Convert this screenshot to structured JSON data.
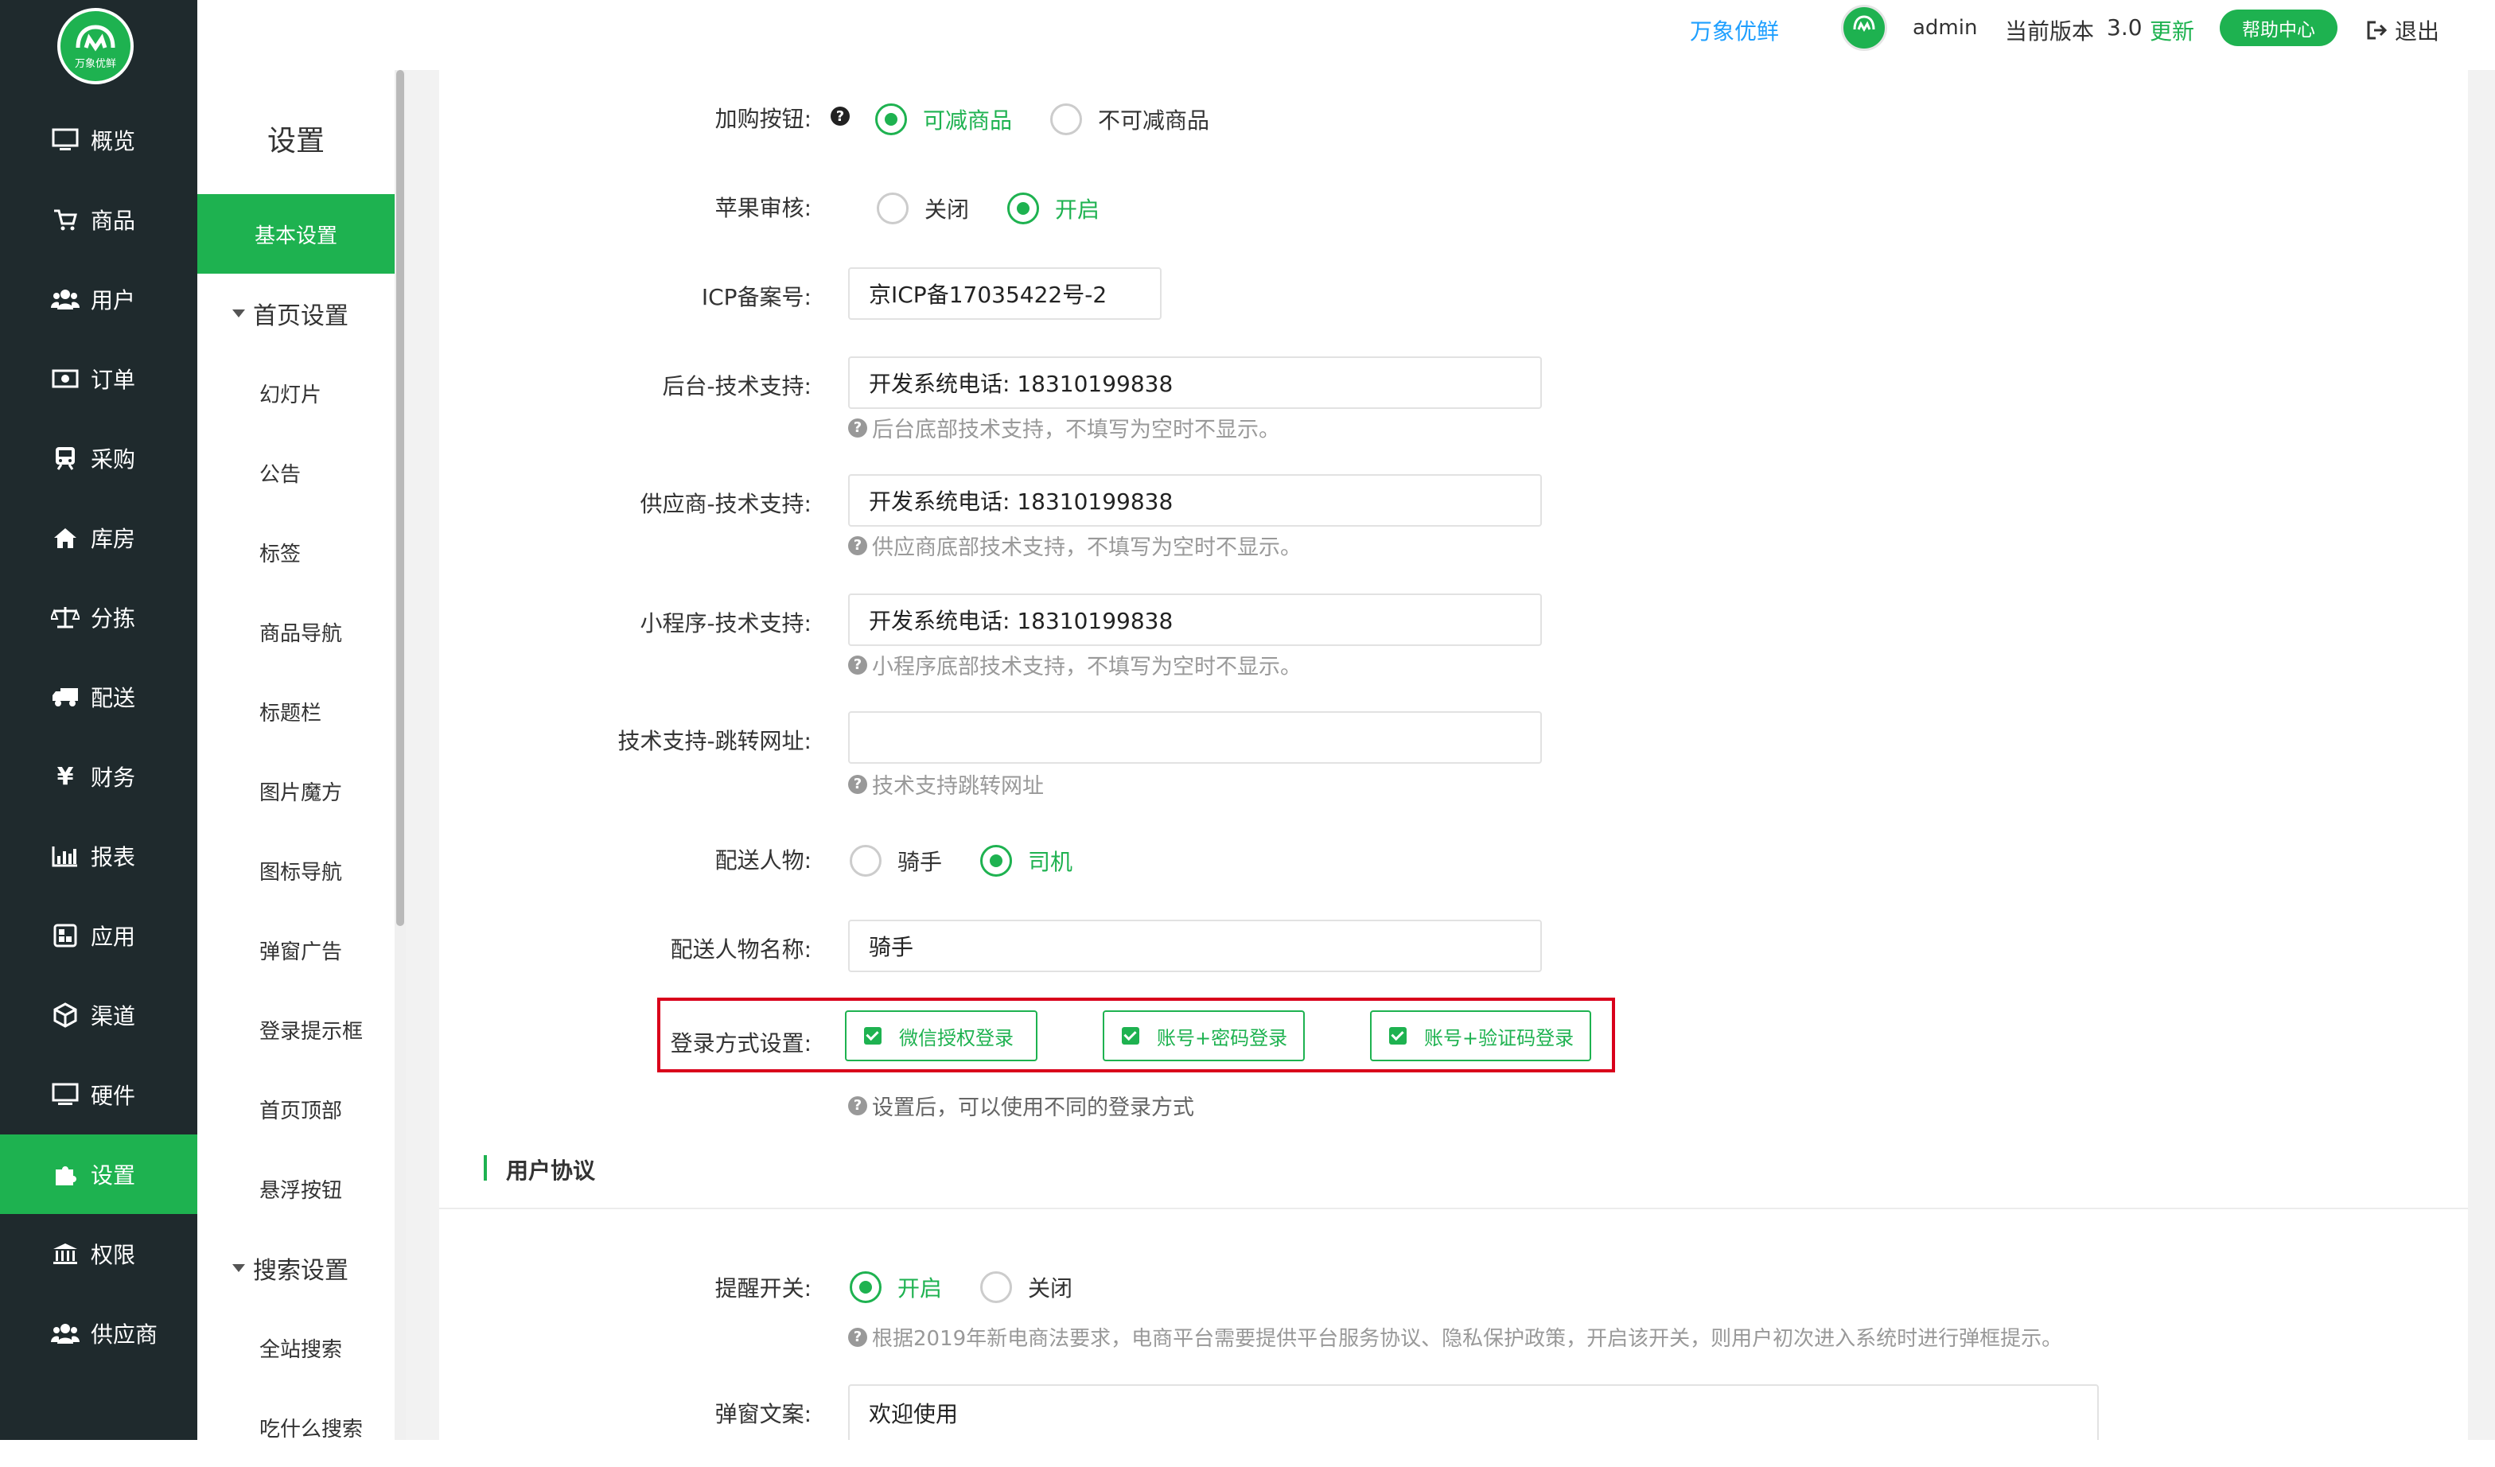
{
  "brand": {
    "name": "万象优鲜",
    "logo_text": "万象优鲜"
  },
  "topbar": {
    "user": "admin",
    "version_label": "当前版本",
    "version": "3.0",
    "update": "更新",
    "help": "帮助中心",
    "logout": "退出"
  },
  "sidebar": {
    "items": [
      {
        "label": "概览",
        "icon": "monitor-icon"
      },
      {
        "label": "商品",
        "icon": "cart-icon"
      },
      {
        "label": "用户",
        "icon": "users-icon"
      },
      {
        "label": "订单",
        "icon": "money-icon"
      },
      {
        "label": "采购",
        "icon": "train-icon"
      },
      {
        "label": "库房",
        "icon": "home-icon"
      },
      {
        "label": "分拣",
        "icon": "scale-icon"
      },
      {
        "label": "配送",
        "icon": "truck-icon"
      },
      {
        "label": "财务",
        "icon": "yen-icon"
      },
      {
        "label": "报表",
        "icon": "bar-chart-icon"
      },
      {
        "label": "应用",
        "icon": "apps-icon"
      },
      {
        "label": "渠道",
        "icon": "cube-icon"
      },
      {
        "label": "硬件",
        "icon": "desktop-icon"
      },
      {
        "label": "设置",
        "icon": "puzzle-icon"
      },
      {
        "label": "权限",
        "icon": "bank-icon"
      },
      {
        "label": "供应商",
        "icon": "group-icon"
      }
    ],
    "active": "设置"
  },
  "subnav": {
    "title": "设置",
    "basic": "基本设置",
    "group_home": "首页设置",
    "home_items": [
      "幻灯片",
      "公告",
      "标签",
      "商品导航",
      "标题栏",
      "图片魔方",
      "图标导航",
      "弹窗广告",
      "登录提示框",
      "首页顶部",
      "悬浮按钮"
    ],
    "group_search": "搜索设置",
    "search_items": [
      "全站搜索",
      "吃什么搜索"
    ]
  },
  "form": {
    "add_button": {
      "label": "加购按钮:",
      "options": [
        "可减商品",
        "不可减商品"
      ],
      "selected": "可减商品"
    },
    "apple_review": {
      "label": "苹果审核:",
      "options": [
        "关闭",
        "开启"
      ],
      "selected": "开启"
    },
    "icp": {
      "label": "ICP备案号:",
      "value": "京ICP备17035422号-2"
    },
    "admin_support": {
      "label": "后台-技术支持:",
      "value": "开发系统电话: 18310199838",
      "help": "后台底部技术支持，不填写为空时不显示。"
    },
    "supplier_support": {
      "label": "供应商-技术支持:",
      "value": "开发系统电话: 18310199838",
      "help": "供应商底部技术支持，不填写为空时不显示。"
    },
    "mini_support": {
      "label": "小程序-技术支持:",
      "value": "开发系统电话: 18310199838",
      "help": "小程序底部技术支持，不填写为空时不显示。"
    },
    "support_url": {
      "label": "技术支持-跳转网址:",
      "value": "",
      "help": "技术支持跳转网址"
    },
    "delivery_person": {
      "label": "配送人物:",
      "options": [
        "骑手",
        "司机"
      ],
      "selected": "司机"
    },
    "delivery_name": {
      "label": "配送人物名称:",
      "value": "骑手"
    },
    "login_methods": {
      "label": "登录方式设置:",
      "options": [
        "微信授权登录",
        "账号+密码登录",
        "账号+验证码登录"
      ],
      "help": "设置后，可以使用不同的登录方式"
    },
    "section_agreement": "用户协议",
    "reminder": {
      "label": "提醒开关:",
      "options": [
        "开启",
        "关闭"
      ],
      "selected": "开启",
      "help": "根据2019年新电商法要求，电商平台需要提供平台服务协议、隐私保护政策，开启该开关，则用户初次进入系统时进行弹框提示。"
    },
    "popup_text": {
      "label": "弹窗文案:",
      "value": "欢迎使用"
    }
  },
  "colors": {
    "accent": "#1eb250",
    "sidebar": "#1f2a2d",
    "highlight": "#d9001b"
  }
}
